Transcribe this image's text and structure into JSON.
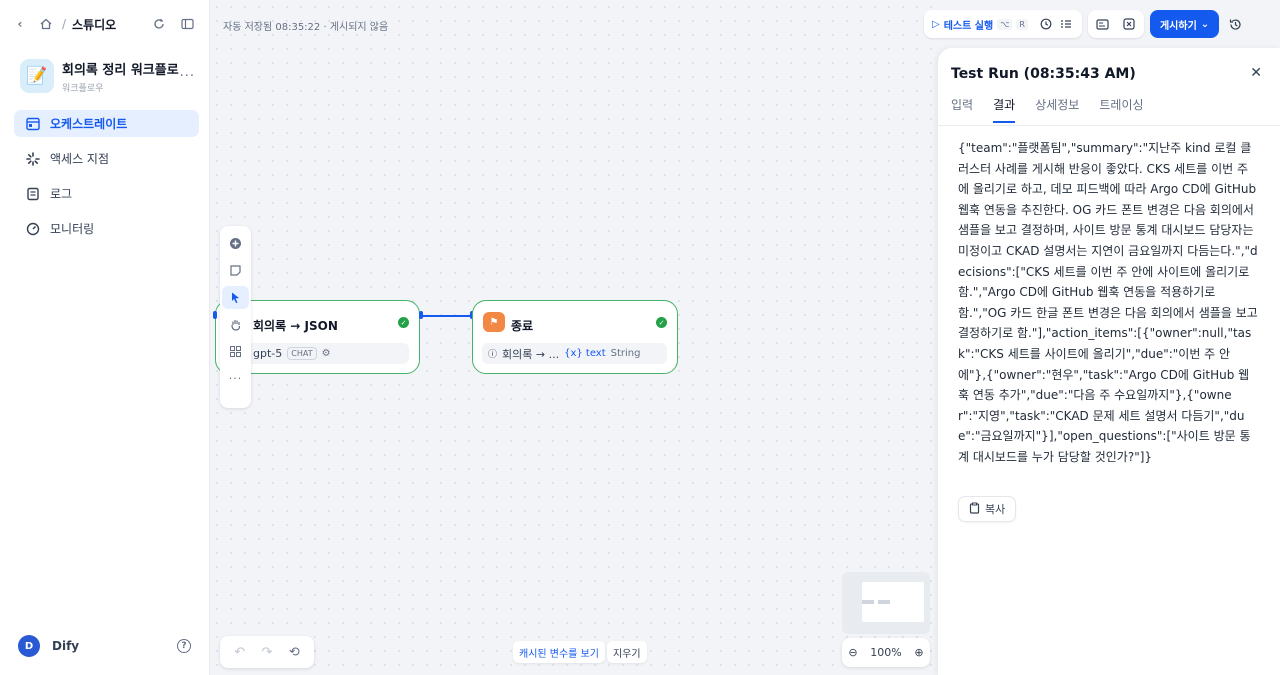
{
  "breadcrumb": {
    "separator": "/",
    "studio": "스튜디오"
  },
  "app": {
    "icon": "📝",
    "name": "회의록 정리 워크플로",
    "type": "워크플로우"
  },
  "nav": [
    {
      "label": "오케스트레이트",
      "icon": "layout-icon",
      "active": true
    },
    {
      "label": "액세스 지점",
      "icon": "access-point-icon",
      "active": false
    },
    {
      "label": "로그",
      "icon": "log-icon",
      "active": false
    },
    {
      "label": "모니터링",
      "icon": "monitoring-icon",
      "active": false
    }
  ],
  "user": {
    "initial": "D",
    "name": "Dify"
  },
  "canvas": {
    "save_status": "자동 저장됨 08:35:22 · 게시되지 않음",
    "nodes": [
      {
        "title": "회의록 → JSON",
        "model": "gpt-5",
        "chip": "CHAT"
      },
      {
        "title": "종료",
        "var_source": "회의록 → ...",
        "var_name": "{x} text",
        "var_type": "String"
      }
    ],
    "view_cached_vars": "캐시된 변수를 보기",
    "clear": "지우기",
    "zoom": "100%"
  },
  "toolbar": {
    "test_run": "테스트 실행",
    "shortcut_1": "⌥",
    "shortcut_2": "R",
    "publish": "게시하기"
  },
  "panel": {
    "title": "Test Run (08:35:43 AM)",
    "tabs": [
      "입력",
      "결과",
      "상세정보",
      "트레이싱"
    ],
    "active_tab": "결과",
    "result_text": "{\"team\":\"플랫폼팀\",\"summary\":\"지난주 kind 로컬 클러스터 사례를 게시해 반응이 좋았다. CKS 세트를 이번 주에 올리기로 하고, 데모 피드백에 따라 Argo CD에 GitHub 웹훅 연동을 추진한다. OG 카드 폰트 변경은 다음 회의에서 샘플을 보고 결정하며, 사이트 방문 통계 대시보드 담당자는 미정이고 CKAD 설명서는 지연이 금요일까지 다듬는다.\",\"decisions\":[\"CKS 세트를 이번 주 안에 사이트에 올리기로 함.\",\"Argo CD에 GitHub 웹훅 연동을 적용하기로 함.\",\"OG 카드 한글 폰트 변경은 다음 회의에서 샘플을 보고 결정하기로 함.\"],\"action_items\":[{\"owner\":null,\"task\":\"CKS 세트를 사이트에 올리기\",\"due\":\"이번 주 안에\"},{\"owner\":\"현우\",\"task\":\"Argo CD에 GitHub 웹훅 연동 추가\",\"due\":\"다음 주 수요일까지\"},{\"owner\":\"지영\",\"task\":\"CKAD 문제 세트 설명서 다듬기\",\"due\":\"금요일까지\"}],\"open_questions\":[\"사이트 방문 통계 대시보드를 누가 담당할 것인가?\"]}",
    "copy": "복사"
  }
}
